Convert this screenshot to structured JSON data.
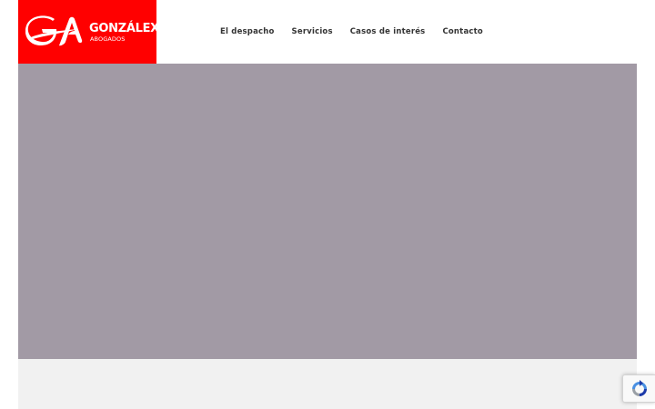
{
  "header": {
    "logo": {
      "name": "GONZÁLEX",
      "subtitle": "ABOGADOS",
      "monogram": "GA"
    },
    "nav": [
      {
        "label": "El despacho"
      },
      {
        "label": "Servicios"
      },
      {
        "label": "Casos de interés"
      },
      {
        "label": "Contacto"
      }
    ]
  },
  "recaptcha": {
    "icon": "recaptcha-icon"
  },
  "colors": {
    "brand": "#ff0000",
    "hero": "#a29aa5",
    "band": "#f1f1f1",
    "nav_text": "#333333"
  }
}
